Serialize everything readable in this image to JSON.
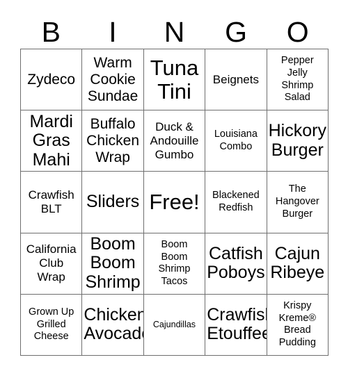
{
  "header": {
    "letters": [
      "B",
      "I",
      "N",
      "G",
      "O"
    ]
  },
  "grid": {
    "rows": 5,
    "columns": 5,
    "free_space_label": "Free!",
    "cells": [
      {
        "text": "Zydeco",
        "size": "lg"
      },
      {
        "text": "Warm\nCookie\nSundae",
        "size": "lg"
      },
      {
        "text": "Tuna\nTini",
        "size": "xxl"
      },
      {
        "text": "Beignets",
        "size": "md"
      },
      {
        "text": "Pepper\nJelly\nShrimp\nSalad",
        "size": "sm"
      },
      {
        "text": "Mardi\nGras\nMahi",
        "size": "xl"
      },
      {
        "text": "Buffalo\nChicken\nWrap",
        "size": "lg"
      },
      {
        "text": "Duck &\nAndouille\nGumbo",
        "size": "md"
      },
      {
        "text": "Louisiana\nCombo",
        "size": "sm"
      },
      {
        "text": "Hickory\nBurger",
        "size": "xl"
      },
      {
        "text": "Crawfish\nBLT",
        "size": "md"
      },
      {
        "text": "Sliders",
        "size": "xl"
      },
      {
        "text": "Free!",
        "size": "xxl"
      },
      {
        "text": "Blackened\nRedfish",
        "size": "sm"
      },
      {
        "text": "The\nHangover\nBurger",
        "size": "sm"
      },
      {
        "text": "California\nClub\nWrap",
        "size": "md"
      },
      {
        "text": "Boom\nBoom\nShrimp",
        "size": "xl"
      },
      {
        "text": "Boom\nBoom\nShrimp\nTacos",
        "size": "sm"
      },
      {
        "text": "Catfish\nPoboys",
        "size": "xl"
      },
      {
        "text": "Cajun\nRibeye",
        "size": "xl"
      },
      {
        "text": "Grown Up\nGrilled\nCheese",
        "size": "sm"
      },
      {
        "text": "Chicken\nAvocado",
        "size": "xl"
      },
      {
        "text": "Cajundillas",
        "size": "xs"
      },
      {
        "text": "Crawfish\nEtouffee",
        "size": "xl"
      },
      {
        "text": "Krispy\nKreme®\nBread\nPudding",
        "size": "sm"
      }
    ]
  },
  "colors": {
    "background": "#ffffff",
    "text": "#000000",
    "border": "#6e6e6e"
  }
}
